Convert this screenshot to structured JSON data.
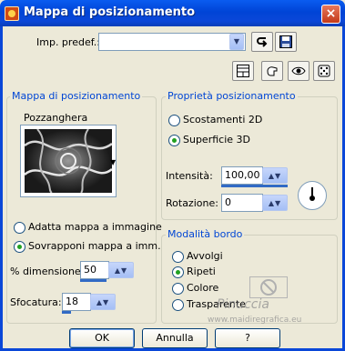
{
  "window": {
    "title": "Mappa di posizionamento",
    "close_glyph": "×"
  },
  "preset": {
    "label": "Imp. predef.:",
    "value": ""
  },
  "icons": {
    "preset_dropdown": "chevron-down-icon",
    "load_preset": "reset-arrow-icon",
    "save_preset": "save-disk-icon",
    "toolbar": [
      "layout-icon",
      "pointing-hand-icon",
      "eye-icon",
      "dice-icon"
    ]
  },
  "map_group": {
    "title": "Mappa di posizionamento",
    "map_name": "Pozzanghera",
    "options": [
      {
        "label": "Adatta mappa a immagine",
        "checked": false
      },
      {
        "label": "Sovrapponi mappa a imm.",
        "checked": true
      }
    ],
    "dimension": {
      "label": "% dimensione:",
      "value": "50",
      "level": 0.5
    },
    "blur": {
      "label": "Sfocatura:",
      "value": "18",
      "level": 0.18
    }
  },
  "props_group": {
    "title": "Proprietà posizionamento",
    "options": [
      {
        "label": "Scostamenti 2D",
        "checked": false
      },
      {
        "label": "Superficie 3D",
        "checked": true
      }
    ],
    "intensity": {
      "label": "Intensità:",
      "value": "100,00"
    },
    "rotation": {
      "label": "Rotazione:",
      "value": "0"
    }
  },
  "edge_group": {
    "title": "Modalità bordo",
    "options": [
      {
        "label": "Avvolgi",
        "checked": false
      },
      {
        "label": "Ripeti",
        "checked": true
      },
      {
        "label": "Colore",
        "checked": false
      },
      {
        "label": "Trasparente",
        "checked": false
      }
    ]
  },
  "buttons": {
    "ok": "OK",
    "cancel": "Annulla",
    "help": "?"
  },
  "watermark": {
    "line1": "Pinuccia",
    "line2": "www.maidiregrafica.eu"
  },
  "colors": {
    "titlebar": "#0a47d8",
    "group_title": "#0046d5",
    "radio_checked": "#21a121",
    "background": "#ece9d8"
  }
}
